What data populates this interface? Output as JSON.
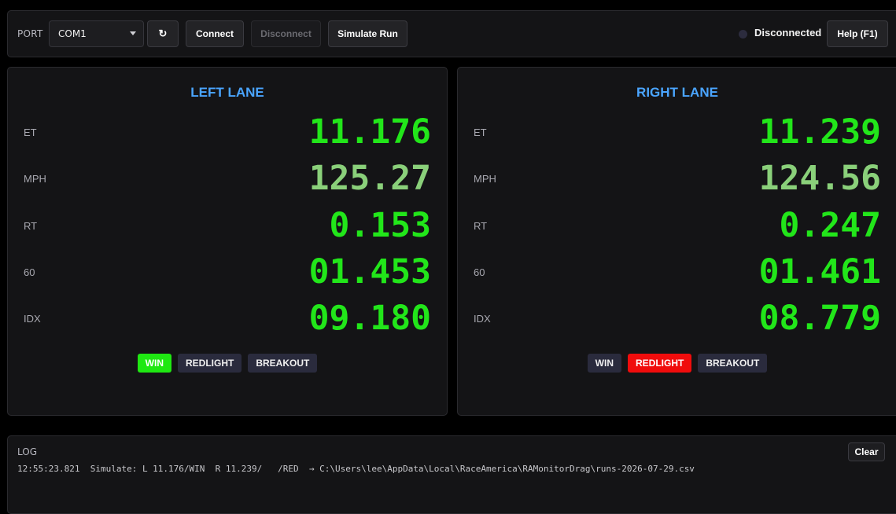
{
  "toolbar": {
    "port_label": "PORT",
    "port_value": "COM1",
    "refresh_glyph": "↻",
    "connect_label": "Connect",
    "disconnect_label": "Disconnect",
    "simulate_label": "Simulate Run",
    "status_text": "Disconnected",
    "help_label": "Help (F1)"
  },
  "left_lane": {
    "title": "LEFT LANE",
    "et_label": "ET",
    "et_value": "11.176",
    "mph_label": "MPH",
    "mph_value": "125.27",
    "rt_label": "RT",
    "rt_value": "0.153",
    "sixty_label": "60",
    "sixty_value": "01.453",
    "idx_label": "IDX",
    "idx_value": "09.180",
    "win_label": "WIN",
    "redlight_label": "REDLIGHT",
    "breakout_label": "BREAKOUT"
  },
  "right_lane": {
    "title": "RIGHT LANE",
    "et_label": "ET",
    "et_value": "11.239",
    "mph_label": "MPH",
    "mph_value": "124.56",
    "rt_label": "RT",
    "rt_value": "0.247",
    "sixty_label": "60",
    "sixty_value": "01.461",
    "idx_label": "IDX",
    "idx_value": "08.779",
    "win_label": "WIN",
    "redlight_label": "REDLIGHT",
    "breakout_label": "BREAKOUT"
  },
  "log": {
    "title": "LOG",
    "clear_label": "Clear",
    "line": "12:55:23.821  Simulate: L 11.176/WIN  R 11.239/   /RED  → C:\\Users\\lee\\AppData\\Local\\RaceAmerica\\RAMonitorDrag\\runs-2026-07-29.csv"
  },
  "colors": {
    "accent_blue": "#4aa5ff",
    "value_green": "#22e61a",
    "mph_green": "#8ad07a",
    "win_green": "#1fe812",
    "redlight_red": "#f00c0c"
  }
}
